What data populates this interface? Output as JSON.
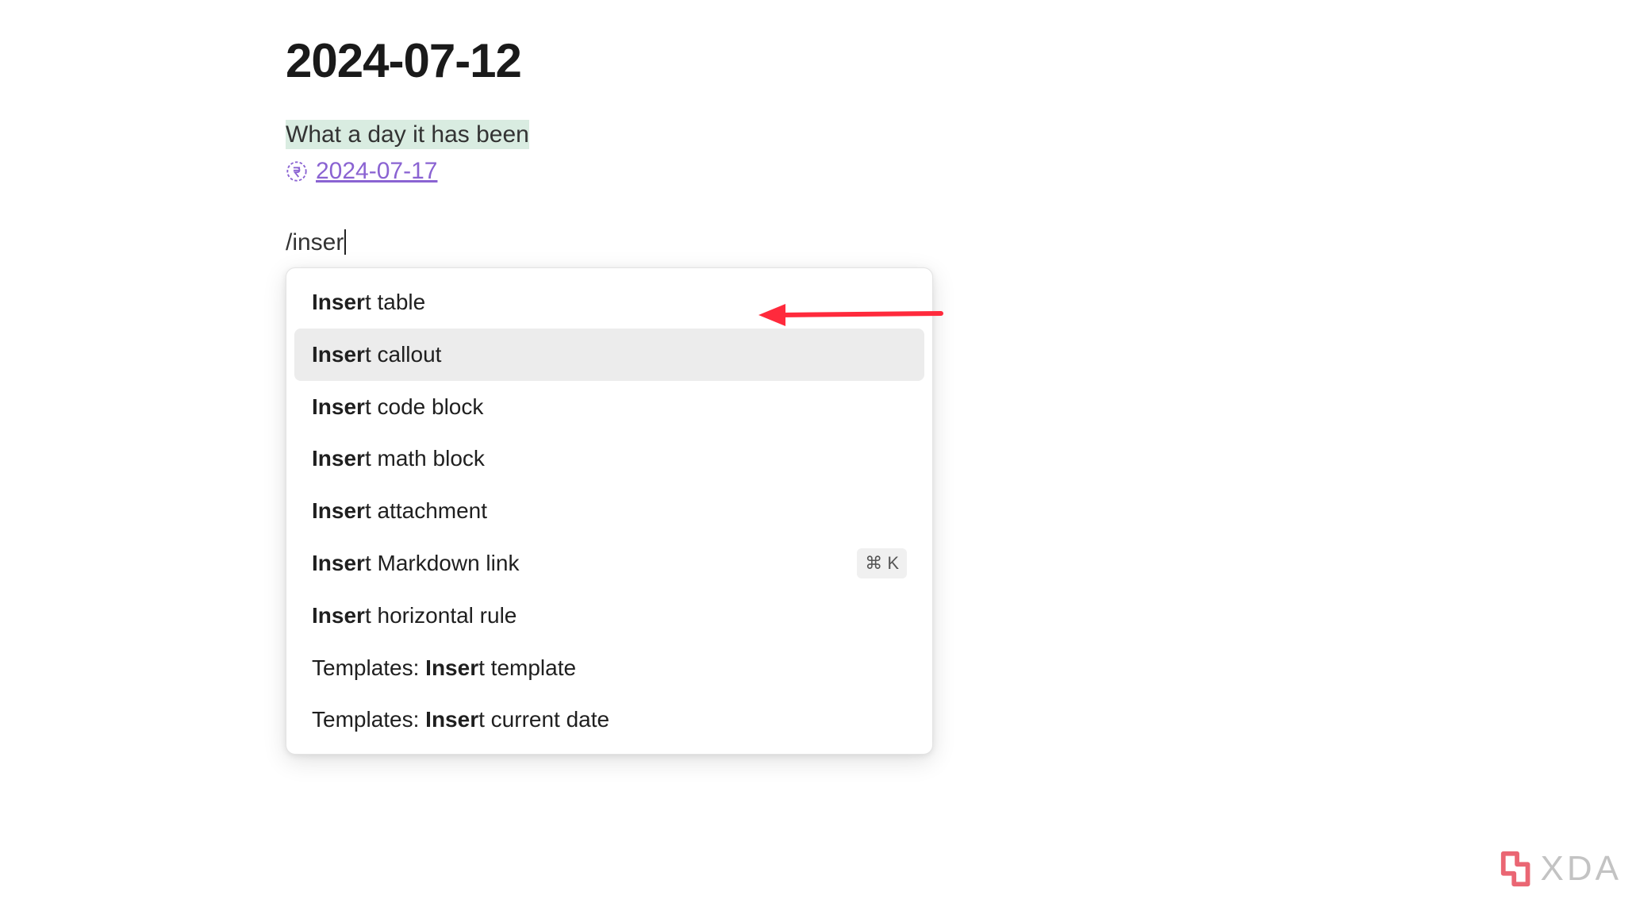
{
  "page": {
    "title": "2024-07-12",
    "highlighted_text": "What a day it has been",
    "link_date": "2024-07-17"
  },
  "command": {
    "text": "/inser"
  },
  "menu": {
    "items": [
      {
        "prefix": "",
        "bold": "Inser",
        "rest": "t table",
        "shortcut": "",
        "selected": false
      },
      {
        "prefix": "",
        "bold": "Inser",
        "rest": "t callout",
        "shortcut": "",
        "selected": true
      },
      {
        "prefix": "",
        "bold": "Inser",
        "rest": "t code block",
        "shortcut": "",
        "selected": false
      },
      {
        "prefix": "",
        "bold": "Inser",
        "rest": "t math block",
        "shortcut": "",
        "selected": false
      },
      {
        "prefix": "",
        "bold": "Inser",
        "rest": "t attachment",
        "shortcut": "",
        "selected": false
      },
      {
        "prefix": "",
        "bold": "Inser",
        "rest": "t Markdown link",
        "shortcut": "⌘ K",
        "selected": false
      },
      {
        "prefix": "",
        "bold": "Inser",
        "rest": "t horizontal rule",
        "shortcut": "",
        "selected": false
      },
      {
        "prefix": "Templates: ",
        "bold": "Inser",
        "rest": "t template",
        "shortcut": "",
        "selected": false
      },
      {
        "prefix": "Templates: ",
        "bold": "Inser",
        "rest": "t current date",
        "shortcut": "",
        "selected": false
      }
    ]
  },
  "watermark": {
    "text": "XDA"
  }
}
